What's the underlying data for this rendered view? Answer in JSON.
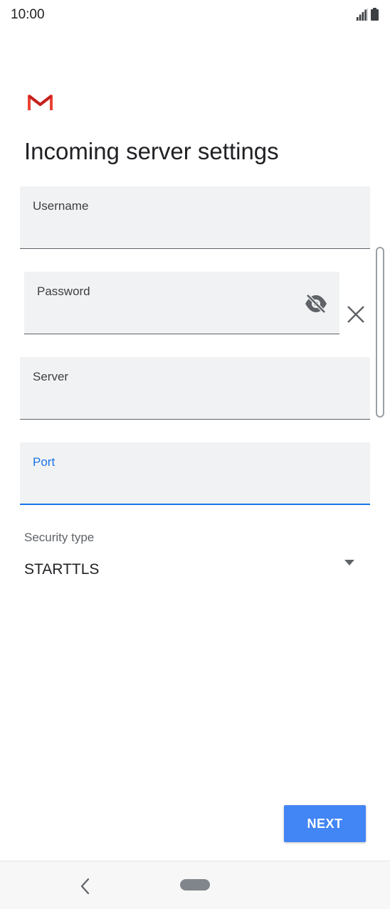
{
  "status_bar": {
    "time": "10:00",
    "icons": [
      "signal-icon",
      "battery-icon"
    ]
  },
  "app": {
    "logo_icon": "gmail-logo-icon",
    "brand_colors": [
      "#ea4335",
      "#c5221f"
    ]
  },
  "page": {
    "title": "Incoming server settings"
  },
  "form": {
    "username": {
      "label": "Username",
      "value": ""
    },
    "password": {
      "label": "Password",
      "value": "",
      "visibility_icon": "eye-off-icon",
      "clear_icon": "close-icon"
    },
    "server": {
      "label": "Server",
      "value": ""
    },
    "port": {
      "label": "Port",
      "value": "",
      "focused": true
    },
    "security_type": {
      "label": "Security type",
      "selected": "STARTTLS",
      "icon": "dropdown-arrow-icon"
    }
  },
  "actions": {
    "next_label": "NEXT"
  },
  "navigation": {
    "back_icon": "back-chevron-icon",
    "home_icon": "home-pill-icon"
  },
  "colors": {
    "accent": "#1a73e8",
    "button": "#4285f4",
    "field_bg": "#f1f2f3"
  }
}
